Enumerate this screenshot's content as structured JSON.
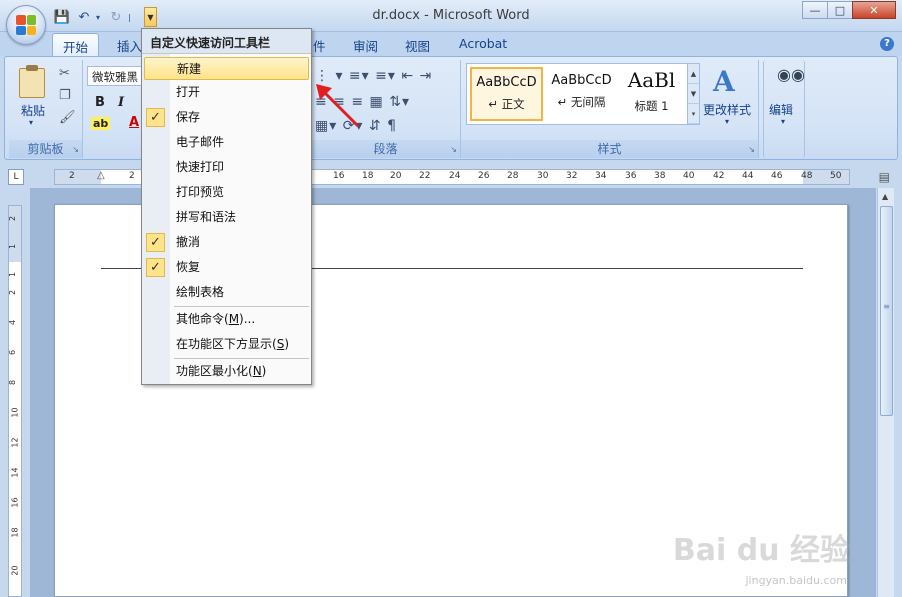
{
  "window": {
    "title": "dr.docx - Microsoft Word",
    "minimize_icon": "minimize-icon",
    "maximize_icon": "maximize-icon",
    "close_icon": "close-icon"
  },
  "qat": {
    "save_icon": "save-icon",
    "undo_icon": "undo-icon",
    "redo_icon": "redo-icon",
    "customize_icon": "customize-dropdown-icon"
  },
  "tabs": [
    {
      "label": "开始"
    },
    {
      "label": "插入"
    },
    {
      "label": "件"
    },
    {
      "label": "审阅"
    },
    {
      "label": "视图"
    },
    {
      "label": "Acrobat"
    }
  ],
  "ribbon": {
    "clipboard": {
      "paste_label": "粘贴",
      "group_label": "剪贴板"
    },
    "font": {
      "font_name": "微软雅黑",
      "bold": "B",
      "italic": "I",
      "color_a": "A"
    },
    "paragraph": {
      "group_label": "段落"
    },
    "styles": {
      "group_label": "样式",
      "items": [
        {
          "sample": "AaBbCcD",
          "name": "↵ 正文"
        },
        {
          "sample": "AaBbCcD",
          "name": "↵ 无间隔"
        },
        {
          "sample": "AaBl",
          "name": "标题 1"
        }
      ],
      "change_styles_label": "更改样式"
    },
    "editing": {
      "label": "编辑"
    }
  },
  "ruler": {
    "marks": [
      "2",
      "2",
      "16",
      "18",
      "20",
      "22",
      "24",
      "26",
      "28",
      "30",
      "32",
      "34",
      "36",
      "38",
      "40",
      "42",
      "44",
      "46",
      "48",
      "50"
    ],
    "corner_label": "L"
  },
  "vruler": {
    "marks": [
      "2",
      "1",
      "1",
      "2",
      "4",
      "6",
      "8",
      "10",
      "12",
      "14",
      "16",
      "18",
      "20"
    ]
  },
  "menu": {
    "title": "自定义快速访问工具栏",
    "items": [
      {
        "label": "新建",
        "checked": false,
        "highlighted": true
      },
      {
        "label": "打开",
        "checked": false
      },
      {
        "label": "保存",
        "checked": true
      },
      {
        "label": "电子邮件",
        "checked": false
      },
      {
        "label": "快速打印",
        "checked": false
      },
      {
        "label": "打印预览",
        "checked": false
      },
      {
        "label": "拼写和语法",
        "checked": false
      },
      {
        "label": "撤消",
        "checked": true
      },
      {
        "label": "恢复",
        "checked": true
      },
      {
        "label": "绘制表格",
        "checked": false
      }
    ],
    "more_commands": {
      "text": "其他命令(",
      "key": "M",
      "tail": ")..."
    },
    "show_below": {
      "text": "在功能区下方显示(",
      "key": "S",
      "tail": ")"
    },
    "minimize_ribbon": {
      "text": "功能区最小化(",
      "key": "N",
      "tail": ")"
    }
  },
  "watermark": {
    "main": "Bai du 经验",
    "sub": "jingyan.baidu.com"
  },
  "colors": {
    "accent": "#15428b",
    "highlight": "#fde38a",
    "arrow": "#e02020"
  }
}
